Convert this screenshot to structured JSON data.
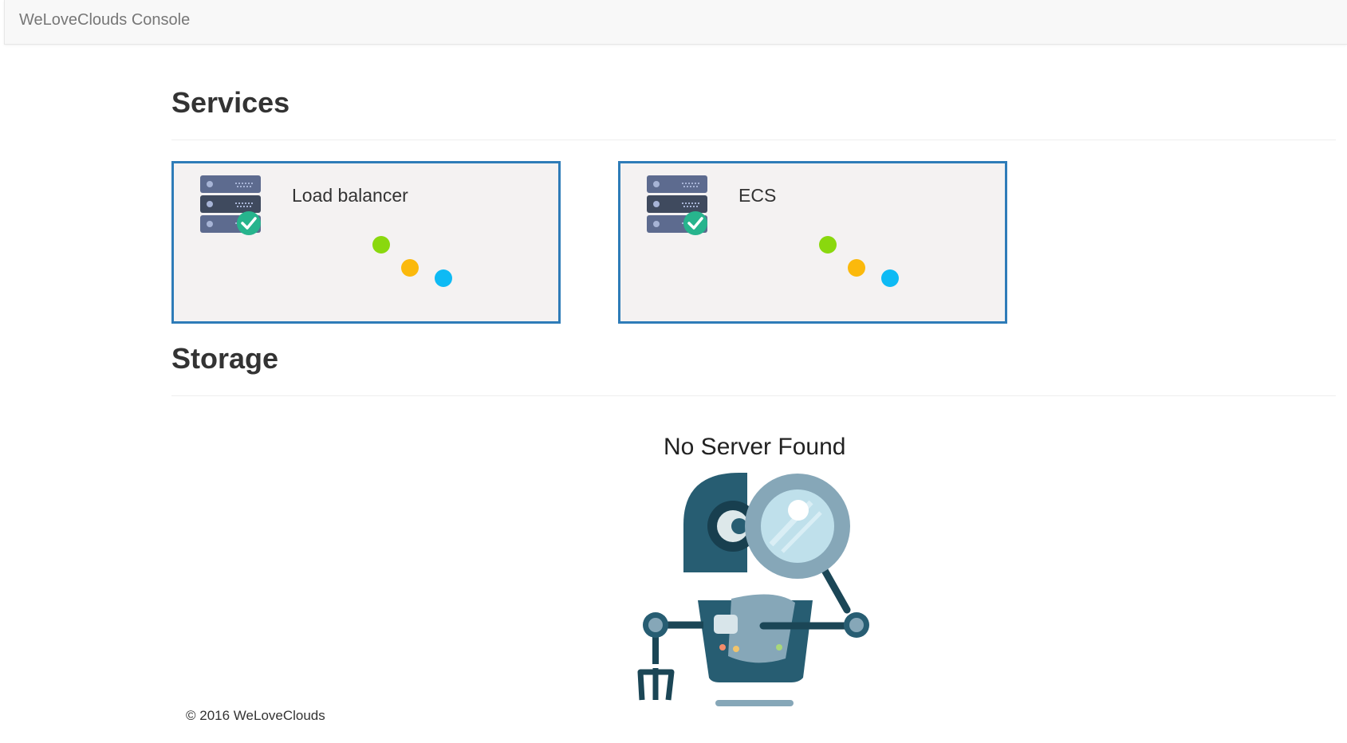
{
  "app": {
    "brand": "WeLoveClouds Console"
  },
  "services": {
    "title": "Services",
    "cards": [
      {
        "label": "Load balancer",
        "icon": "server-check-icon"
      },
      {
        "label": "ECS",
        "icon": "server-check-icon"
      }
    ],
    "status_dot_colors": [
      "#8ad80e",
      "#fbb90c",
      "#0ebaf4"
    ]
  },
  "storage": {
    "title": "Storage",
    "empty_message": "No Server Found",
    "empty_illustration": "robot-magnifier-icon"
  },
  "footer": {
    "copyright": "© 2016 WeLoveClouds"
  },
  "colors": {
    "card_border": "#2e7cb8",
    "card_background": "#f4f2f2",
    "check_badge": "#27b48d"
  }
}
